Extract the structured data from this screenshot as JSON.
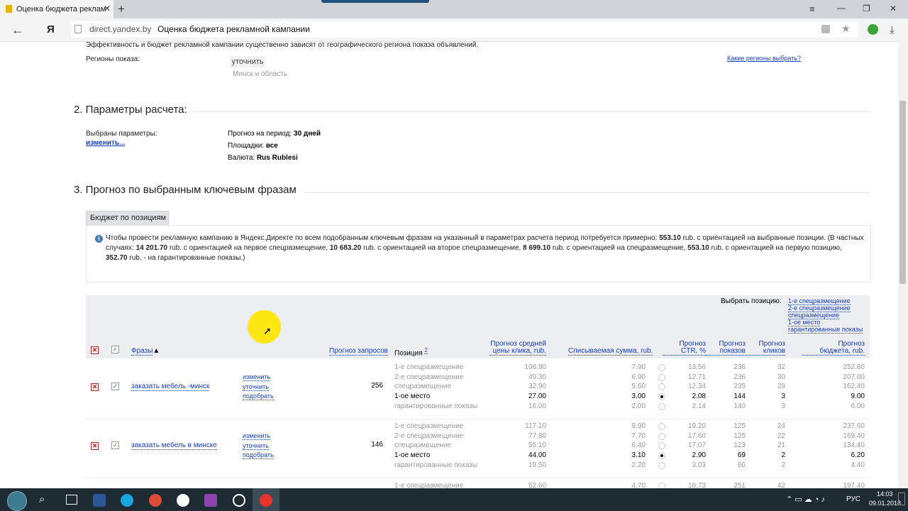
{
  "browser": {
    "tab_title": "Оценка бюджета реклам",
    "new_tab": "+",
    "yandex_logo": "Я",
    "url_domain": "direct.yandex.by",
    "url_title": "Оценка бюджета рекламной кампании",
    "window_controls": [
      "≡",
      "—",
      "❐",
      "✕"
    ]
  },
  "regions": {
    "note": "Эффективность и бюджет рекламной кампании существенно зависят от географического региона показа объявлений.",
    "label": "Регионы показа:",
    "refine_btn": "уточнить",
    "value": "Минск и область",
    "help_link": "Какие регионы выбрать?"
  },
  "params": {
    "title": "2. Параметры расчета:",
    "selected_label": "Выбраны параметры:",
    "change_link": "изменить...",
    "period_label": "Прогноз на период:",
    "period_value": "30 дней",
    "sites_label": "Площадки:",
    "sites_value": "все",
    "currency_label": "Валюта:",
    "currency_value": "Rus Rublesi"
  },
  "forecast": {
    "title": "3. Прогноз по выбранным ключевым фразам",
    "tab": "Бюджет по позициям",
    "info_icon": "info-icon",
    "info": {
      "t1": "Чтобы провести рекламную кампанию в Яндекс.Директе по всем подобранным ключевым фразам на указанный в параметрах расчета период потребуется примерно: ",
      "v1": "553.10",
      "t2": " rub. с ориентацией на выбранные позиции. (В частных случаях: ",
      "v2": "14 201.70",
      "t3": " rub. с ориентацией на первое спецразмещение, ",
      "v3": "10 683.20",
      "t4": " rub. с ориентацией на второе спецразмещение, ",
      "v4": "8 699.10",
      "t5": " rub. с ориентацией на спецразмещение, ",
      "v5": "553.10",
      "t6": " rub. с ориентацией на первую позицию, ",
      "v6": "352.70",
      "t7": " rub. - на гарантированные показы.)"
    }
  },
  "table": {
    "choose_label": "Выбрать позицию:",
    "choose_links": [
      "1-е спецразмещение",
      "2-е спецразмещение",
      "спецразмещение",
      "1-ое место",
      "гарантированные показы"
    ],
    "headers": {
      "phrases": "Фразы",
      "sort_arrow": "▲",
      "queries": "Прогноз запросов",
      "position": "Позиция",
      "position_sup": "2",
      "cpc": [
        "Прогноз средней",
        "цены клика, rub."
      ],
      "spend": "Списываемая сумма, rub.",
      "ctr": [
        "Прогноз",
        "CTR, %"
      ],
      "shows": [
        "Прогноз",
        "показов"
      ],
      "clicks": [
        "Прогноз",
        "кликов"
      ],
      "budget": [
        "Прогноз",
        "бюджета, rub."
      ]
    },
    "row_actions": [
      "изменить",
      "уточнить",
      "подобрать"
    ],
    "keywords": [
      {
        "phrase": "заказать мебель -минск",
        "queries": "256",
        "selected": 3,
        "positions": [
          {
            "name": "1-е спецразмещение",
            "cpc": "106.90",
            "spend": "7.90",
            "ctr": "13.56",
            "shows": "236",
            "clicks": "32",
            "budget": "252.80"
          },
          {
            "name": "2-е спецразмещение",
            "cpc": "49.30",
            "spend": "6.90",
            "ctr": "12.71",
            "shows": "236",
            "clicks": "30",
            "budget": "207.00"
          },
          {
            "name": "спецразмещение",
            "cpc": "32.90",
            "spend": "5.60",
            "ctr": "12.34",
            "shows": "235",
            "clicks": "29",
            "budget": "162.40"
          },
          {
            "name": "1-ое место",
            "cpc": "27.00",
            "spend": "3.00",
            "ctr": "2.08",
            "shows": "144",
            "clicks": "3",
            "budget": "9.00"
          },
          {
            "name": "гарантированные показы",
            "cpc": "16.00",
            "spend": "2.00",
            "ctr": "2.14",
            "shows": "140",
            "clicks": "3",
            "budget": "6.00"
          }
        ]
      },
      {
        "phrase": "заказать мебель в минске",
        "queries": "146",
        "selected": 3,
        "positions": [
          {
            "name": "1-е спецразмещение",
            "cpc": "117.10",
            "spend": "9.90",
            "ctr": "19.20",
            "shows": "125",
            "clicks": "24",
            "budget": "237.60"
          },
          {
            "name": "2-е спецразмещение",
            "cpc": "77.80",
            "spend": "7.70",
            "ctr": "17.60",
            "shows": "125",
            "clicks": "22",
            "budget": "169.40"
          },
          {
            "name": "спецразмещение",
            "cpc": "55.10",
            "spend": "6.40",
            "ctr": "17.07",
            "shows": "123",
            "clicks": "21",
            "budget": "134.40"
          },
          {
            "name": "1-ое место",
            "cpc": "44.00",
            "spend": "3.10",
            "ctr": "2.90",
            "shows": "69",
            "clicks": "2",
            "budget": "6.20"
          },
          {
            "name": "гарантированные показы",
            "cpc": "19.50",
            "spend": "2.20",
            "ctr": "3.03",
            "shows": "66",
            "clicks": "2",
            "budget": "4.40"
          }
        ]
      },
      {
        "phrase": "",
        "queries": "",
        "selected": -1,
        "positions": [
          {
            "name": "1-е спецразмещение",
            "cpc": "52.60",
            "spend": "4.70",
            "ctr": "16.73",
            "shows": "251",
            "clicks": "42",
            "budget": "197.40"
          }
        ]
      }
    ]
  },
  "taskbar": {
    "lang": "РУС",
    "time": "14:03",
    "date": "09.01.2018",
    "apps": [
      "start-icon",
      "search-icon",
      "task-view-icon",
      "word-icon",
      "skype-icon",
      "chrome-icon",
      "info-app-icon",
      "media-app-icon",
      "settings-app-icon",
      "yandex-browser-icon"
    ]
  },
  "colors": {
    "link": "#1a3dc1",
    "table_header_bg": "#eceef1",
    "taskbar_bg": "#1e2b33",
    "cursor_highlight": "#ffe600"
  }
}
